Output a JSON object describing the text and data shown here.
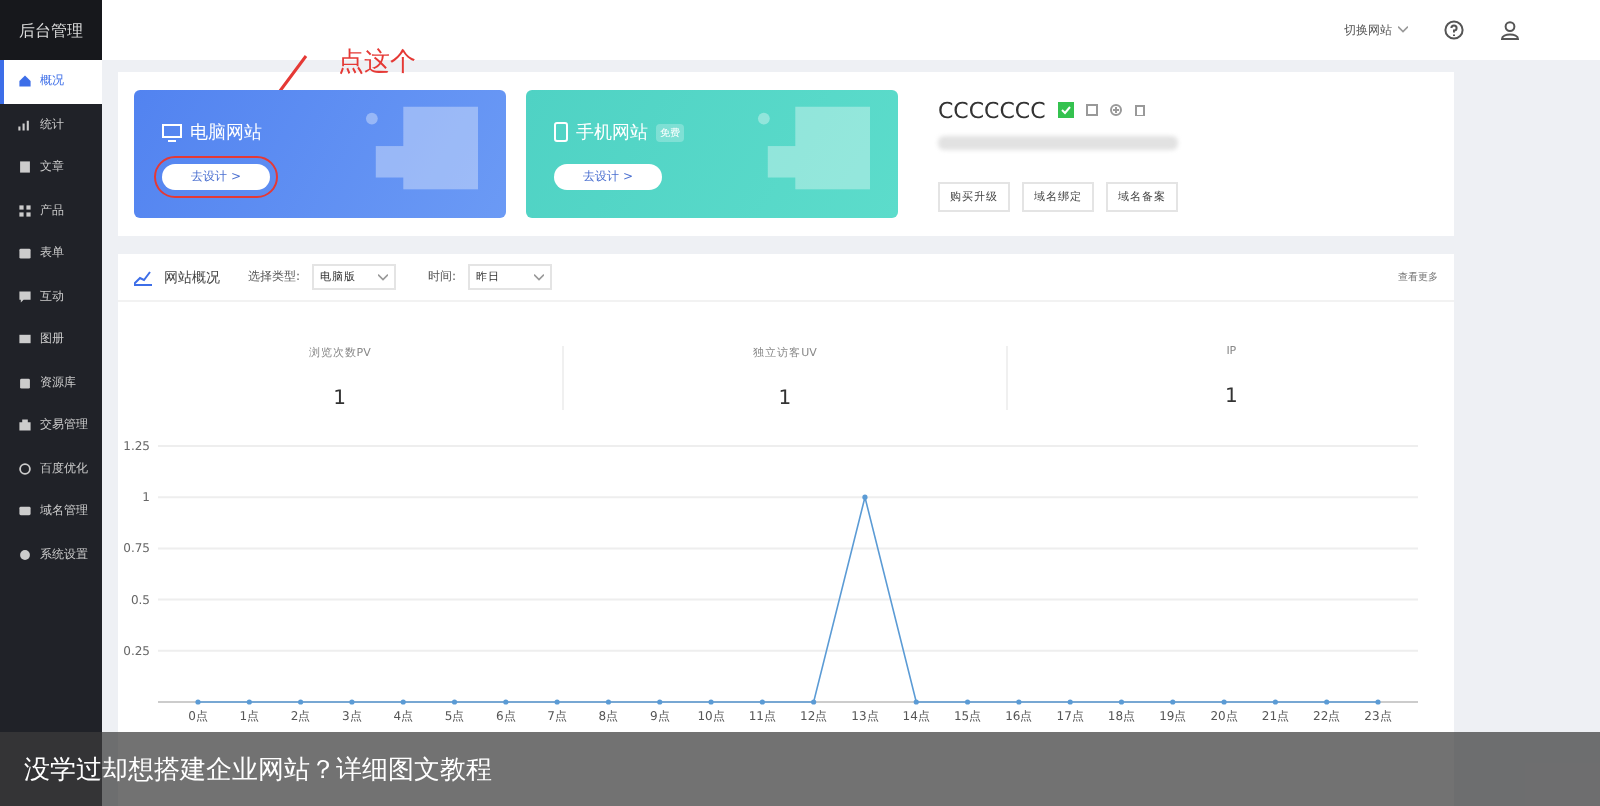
{
  "sidebar": {
    "title": "后台管理",
    "items": [
      {
        "label": "概况",
        "selected": true
      },
      {
        "label": "统计",
        "selected": false
      },
      {
        "label": "文章",
        "selected": false
      },
      {
        "label": "产品",
        "selected": false
      },
      {
        "label": "表单",
        "selected": false
      },
      {
        "label": "互动",
        "selected": false
      },
      {
        "label": "图册",
        "selected": false
      },
      {
        "label": "资源库",
        "selected": false
      },
      {
        "label": "交易管理",
        "selected": false
      },
      {
        "label": "百度优化",
        "selected": false
      },
      {
        "label": "域名管理",
        "selected": false
      },
      {
        "label": "系统设置",
        "selected": false
      }
    ]
  },
  "header": {
    "switch_site": "切换网站"
  },
  "site_cards": [
    {
      "kind": "pc",
      "title": "电脑网站",
      "button": "去设计 >"
    },
    {
      "kind": "mobile",
      "title": "手机网站",
      "badge": "免费",
      "button": "去设计 >"
    }
  ],
  "site_info": {
    "name": "CCCCCCC",
    "buttons": [
      "购买升级",
      "域名绑定",
      "域名备案"
    ]
  },
  "annotation": {
    "text": "点这个"
  },
  "overview": {
    "title": "网站概况",
    "type_label": "选择类型:",
    "type_value": "电脑版",
    "time_label": "时间:",
    "time_value": "昨日",
    "more": "查看更多",
    "stats": [
      {
        "label": "浏览次数PV",
        "value": "1"
      },
      {
        "label": "独立访客UV",
        "value": "1"
      },
      {
        "label": "IP",
        "value": "1"
      }
    ],
    "chart_data": {
      "type": "line",
      "categories": [
        "0点",
        "1点",
        "2点",
        "3点",
        "4点",
        "5点",
        "6点",
        "7点",
        "8点",
        "9点",
        "10点",
        "11点",
        "12点",
        "13点",
        "14点",
        "15点",
        "16点",
        "17点",
        "18点",
        "19点",
        "20点",
        "21点",
        "22点",
        "23点"
      ],
      "series": [
        {
          "color": "#5b9bd5",
          "values": [
            0,
            0,
            0,
            0,
            0,
            0,
            0,
            0,
            0,
            0,
            0,
            0,
            0,
            1,
            0,
            0,
            0,
            0,
            0,
            0,
            0,
            0,
            0,
            0
          ]
        }
      ],
      "ylim": [
        0,
        1.25
      ],
      "grid": true,
      "yticks": [
        0.25,
        0.5,
        0.75,
        1,
        1.25
      ]
    }
  },
  "caption": "没学过却想搭建企业网站？详细图文教程"
}
